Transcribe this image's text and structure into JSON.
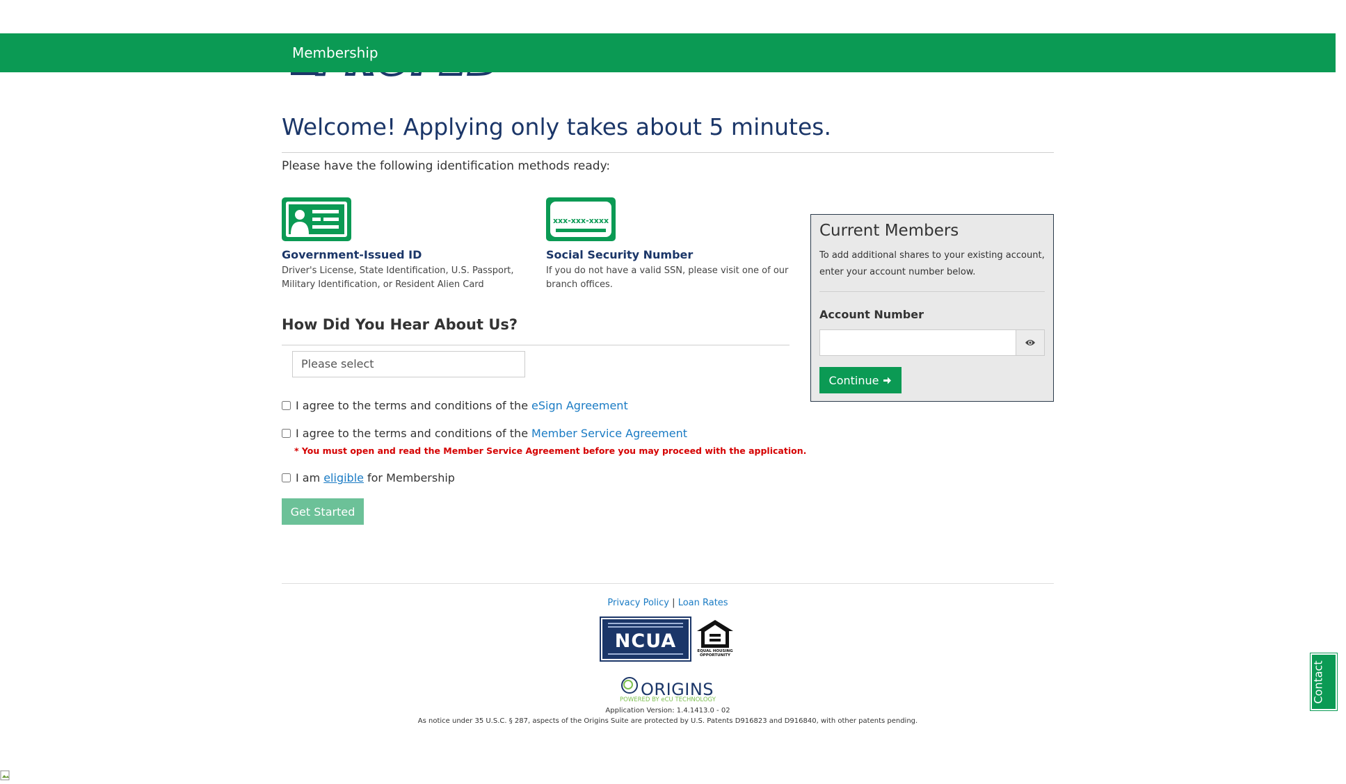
{
  "navbar": {
    "brand": "Membership"
  },
  "logo": {
    "text": "PROFED"
  },
  "main": {
    "welcome": "Welcome! Applying only takes about 5 minutes.",
    "intro": "Please have the following identification methods ready:",
    "id_methods": [
      {
        "title": "Government-Issued ID",
        "desc": "Driver's License, State Identification, U.S. Passport, Military Identification, or Resident Alien Card",
        "icon": "id-card-icon"
      },
      {
        "title": "Social Security Number",
        "desc": "If you do not have a valid SSN, please visit one of our branch offices.",
        "icon": "ssn-card-icon",
        "card_text": "xxx-xxx-xxxx"
      }
    ],
    "hear_heading": "How Did You Hear About Us?",
    "hear_placeholder": "Please select",
    "agreements": {
      "esign_prefix": "I agree to the terms and conditions of the",
      "esign_link": "eSign Agreement",
      "msa_prefix": "I agree to the terms and conditions of the",
      "msa_link": "Member Service Agreement",
      "msa_warning": "* You must open and read the Member Service Agreement before you may proceed with the application.",
      "eligible_prefix": "I am",
      "eligible_link": "eligible",
      "eligible_suffix": "for Membership"
    },
    "get_started": "Get Started"
  },
  "current_members": {
    "title": "Current Members",
    "desc": "To add additional shares to your existing account, enter your account number below.",
    "account_label": "Account Number",
    "account_value": "",
    "continue_label": "Continue"
  },
  "footer": {
    "privacy": "Privacy Policy",
    "separator": "|",
    "loan_rates": "Loan Rates",
    "ncua_text": "NCUA",
    "eho_text": "EQUAL HOUSING OPPORTUNITY",
    "origins_text": "ORIGINS",
    "origins_sub": "POWERED BY eCU TECHNOLOGY",
    "app_version": "Application Version: 1.4.1413.0 - 02",
    "patent": "As notice under 35 U.S.C. § 287, aspects of the Origins Suite are protected by U.S. Patents D916823 and D916840, with other patents pending."
  },
  "contact_tab": "Contact",
  "colors": {
    "brand_green": "#0b9a54",
    "navy": "#1b3668",
    "link_blue": "#1a7bc4",
    "warning_red": "#d50000"
  }
}
